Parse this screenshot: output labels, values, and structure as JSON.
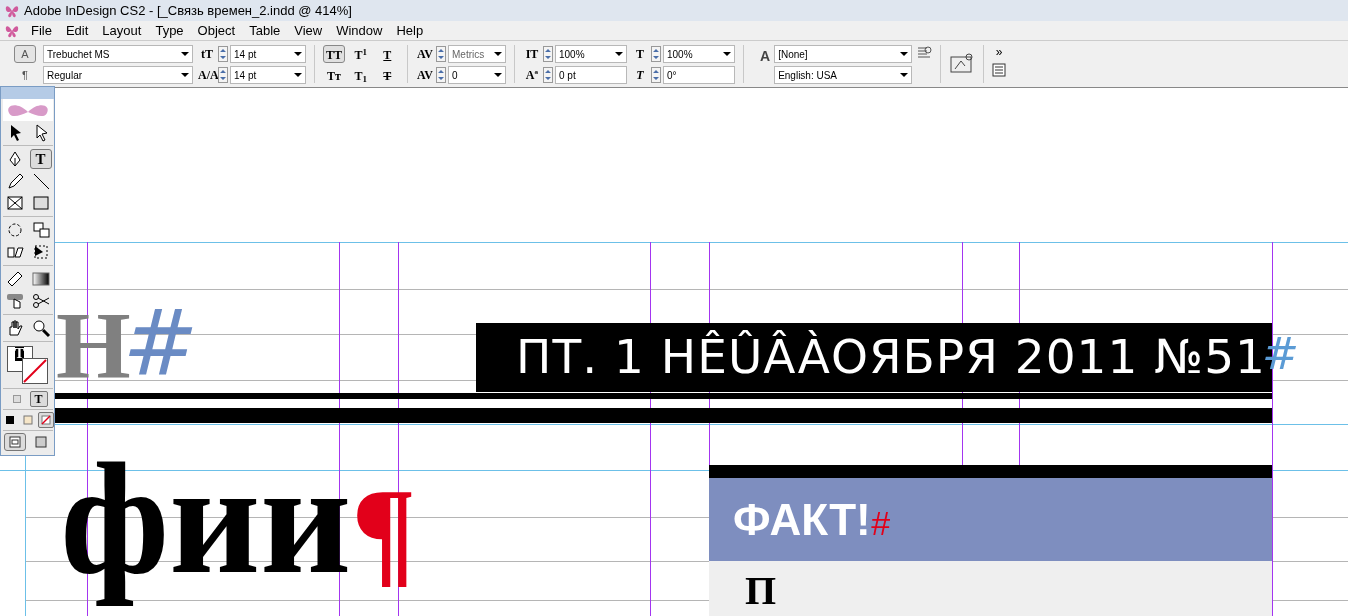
{
  "window": {
    "title": "Adobe InDesign CS2 - [_Связь времен_2.indd @ 414%]"
  },
  "menu": [
    "File",
    "Edit",
    "Layout",
    "Type",
    "Object",
    "Table",
    "View",
    "Window",
    "Help"
  ],
  "control_panel": {
    "modes": [
      {
        "label": "A",
        "selected": true
      },
      {
        "label": "¶",
        "selected": false
      }
    ],
    "font_family": "Trebuchet MS",
    "font_style": "Regular",
    "left_fields": [
      {
        "glyph": "tT",
        "value": "14 pt"
      },
      {
        "glyph": "A/A",
        "value": "14 pt"
      }
    ],
    "style_buttons": [
      {
        "label": "TT",
        "kind": "plain",
        "selected": true
      },
      {
        "label": "T$^{1}$",
        "kind": "plain",
        "selected": false
      },
      {
        "label": "T",
        "kind": "underline",
        "selected": false
      },
      {
        "label": "Tт",
        "kind": "plain",
        "selected": false
      },
      {
        "label": "T$_{1}$",
        "kind": "plain",
        "selected": false
      },
      {
        "label": "T",
        "kind": "strike",
        "selected": false
      }
    ],
    "kerning": {
      "glyph": "AV",
      "value": "Metrics",
      "disabled": true
    },
    "tracking": {
      "glyph": "AV",
      "value": "0"
    },
    "scale_fields": [
      {
        "glyph": "IT",
        "value": "100%",
        "dropdown": true
      },
      {
        "glyph": "T",
        "value": "100%",
        "dropdown": true
      },
      {
        "glyph": "Aª",
        "value": "0 pt",
        "dropdown": false
      },
      {
        "glyph": "T",
        "value": "0°",
        "dropdown": false
      }
    ],
    "character_style_glyph": "A",
    "character_style": "[None]",
    "language": "English: USA",
    "more": "»"
  },
  "toolbox": {
    "tools": [
      {
        "kind": "selection",
        "selected": false
      },
      {
        "kind": "direct-selection",
        "selected": false
      },
      {
        "kind": "pen",
        "selected": false
      },
      {
        "kind": "type",
        "label": "T",
        "selected": true
      },
      {
        "kind": "pencil",
        "selected": false
      },
      {
        "kind": "line",
        "selected": false
      },
      {
        "kind": "frame",
        "selected": false
      },
      {
        "kind": "rectangle",
        "selected": false
      },
      {
        "kind": "rotate",
        "selected": false
      },
      {
        "kind": "scale",
        "selected": false
      },
      {
        "kind": "shear",
        "selected": false
      },
      {
        "kind": "transform",
        "selected": false
      },
      {
        "kind": "measure",
        "selected": false
      },
      {
        "kind": "gradient",
        "selected": false
      },
      {
        "kind": "button",
        "selected": false
      },
      {
        "kind": "scissors",
        "selected": false
      },
      {
        "kind": "hand",
        "selected": false
      },
      {
        "kind": "zoom",
        "selected": false
      }
    ],
    "fill_glyph": "T",
    "formatting": [
      {
        "selected": false
      },
      {
        "label": "T",
        "selected": true
      }
    ],
    "apply": [
      {
        "kind": "color",
        "selected": false
      },
      {
        "kind": "gradient",
        "selected": false
      },
      {
        "kind": "none",
        "selected": true
      }
    ],
    "views": [
      {
        "kind": "normal",
        "selected": true
      },
      {
        "kind": "preview",
        "selected": false
      }
    ]
  },
  "document": {
    "heading_letter": "Н",
    "heading_mark": "#",
    "dateline": "ПТ. 1 НÊÛÂÀОЯБРЯ 2011 №51",
    "dateline_mark": "#",
    "fact_title": "ФАКТ!",
    "fact_mark": "#",
    "fact_body": "П",
    "big_text": "фии",
    "big_mark": "¶"
  }
}
